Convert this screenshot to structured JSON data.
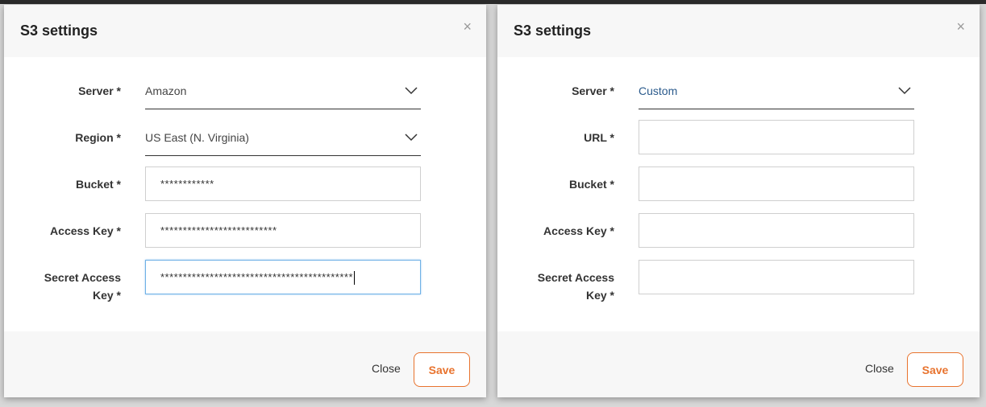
{
  "colors": {
    "accent": "#e8732e",
    "link_value": "#2a5a8c",
    "focus": "#6fb1e6"
  },
  "dialogs": [
    {
      "title": "S3 settings",
      "close_symbol": "×",
      "fields": {
        "server": {
          "label": "Server *",
          "value": "Amazon"
        },
        "region": {
          "label": "Region *",
          "value": "US East (N. Virginia)"
        },
        "bucket": {
          "label": "Bucket *",
          "value": "************"
        },
        "access_key": {
          "label": "Access Key *",
          "value": "**************************"
        },
        "secret_access_key": {
          "label_line1": "Secret Access",
          "label_line2": "Key *",
          "value": "*******************************************"
        }
      },
      "footer": {
        "close_label": "Close",
        "save_label": "Save"
      }
    },
    {
      "title": "S3 settings",
      "close_symbol": "×",
      "fields": {
        "server": {
          "label": "Server *",
          "value": "Custom"
        },
        "url": {
          "label": "URL *",
          "value": ""
        },
        "bucket": {
          "label": "Bucket *",
          "value": ""
        },
        "access_key": {
          "label": "Access Key *",
          "value": ""
        },
        "secret_access_key": {
          "label_line1": "Secret Access",
          "label_line2": "Key *",
          "value": ""
        }
      },
      "footer": {
        "close_label": "Close",
        "save_label": "Save"
      }
    }
  ]
}
